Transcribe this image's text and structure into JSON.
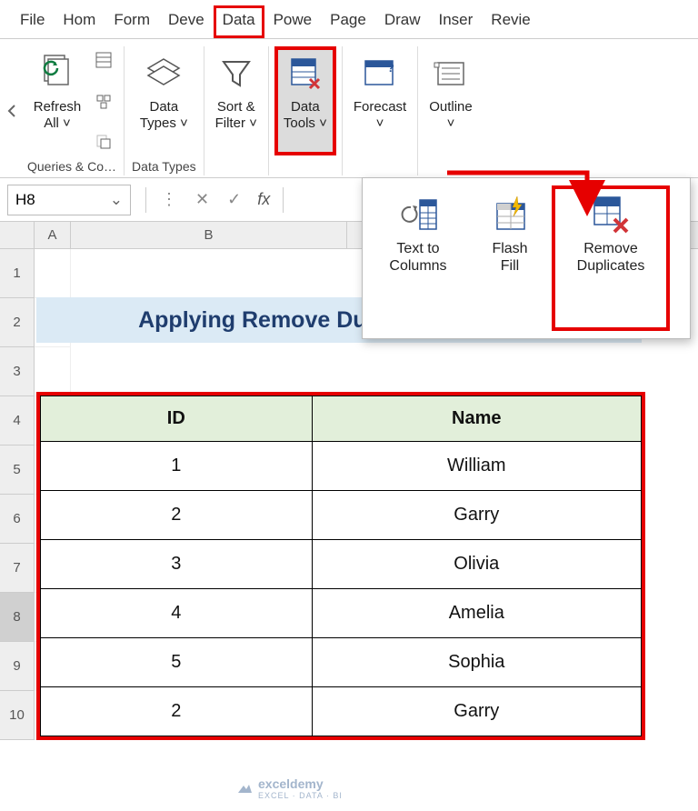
{
  "menu": {
    "tabs": [
      "File",
      "Hom",
      "Form",
      "Deve",
      "Data",
      "Powe",
      "Page",
      "Draw",
      "Inser",
      "Revie"
    ],
    "active_index": 4
  },
  "ribbon": {
    "refresh_label": "Refresh\nAll",
    "data_types_label": "Data\nTypes",
    "sort_filter_label": "Sort &\nFilter",
    "data_tools_label": "Data\nTools",
    "forecast_label": "Forecast",
    "outline_label": "Outline",
    "group_queries": "Queries & Co…",
    "group_datatypes": "Data Types"
  },
  "dropdown": {
    "text_to_columns": "Text to\nColumns",
    "flash_fill": "Flash\nFill",
    "remove_duplicates": "Remove\nDuplicates"
  },
  "formula_bar": {
    "name_box": "H8",
    "fx": "fx"
  },
  "columns": [
    "A",
    "B"
  ],
  "row_numbers": [
    "1",
    "2",
    "3",
    "4",
    "5",
    "6",
    "7",
    "8",
    "9",
    "10"
  ],
  "title_text": "Applying Remove Duplicates Feature",
  "table": {
    "headers": [
      "ID",
      "Name"
    ],
    "rows": [
      {
        "id": "1",
        "name": "William"
      },
      {
        "id": "2",
        "name": "Garry"
      },
      {
        "id": "3",
        "name": "Olivia"
      },
      {
        "id": "4",
        "name": "Amelia"
      },
      {
        "id": "5",
        "name": "Sophia"
      },
      {
        "id": "2",
        "name": "Garry"
      }
    ]
  },
  "watermark": {
    "brand": "exceldemy",
    "sub": "EXCEL · DATA · BI"
  },
  "colors": {
    "highlight": "#e60000",
    "accent_blue": "#2b579a",
    "table_header": "#e2efda",
    "banner": "#dbeaf5",
    "banner_text": "#1f3d6e"
  }
}
